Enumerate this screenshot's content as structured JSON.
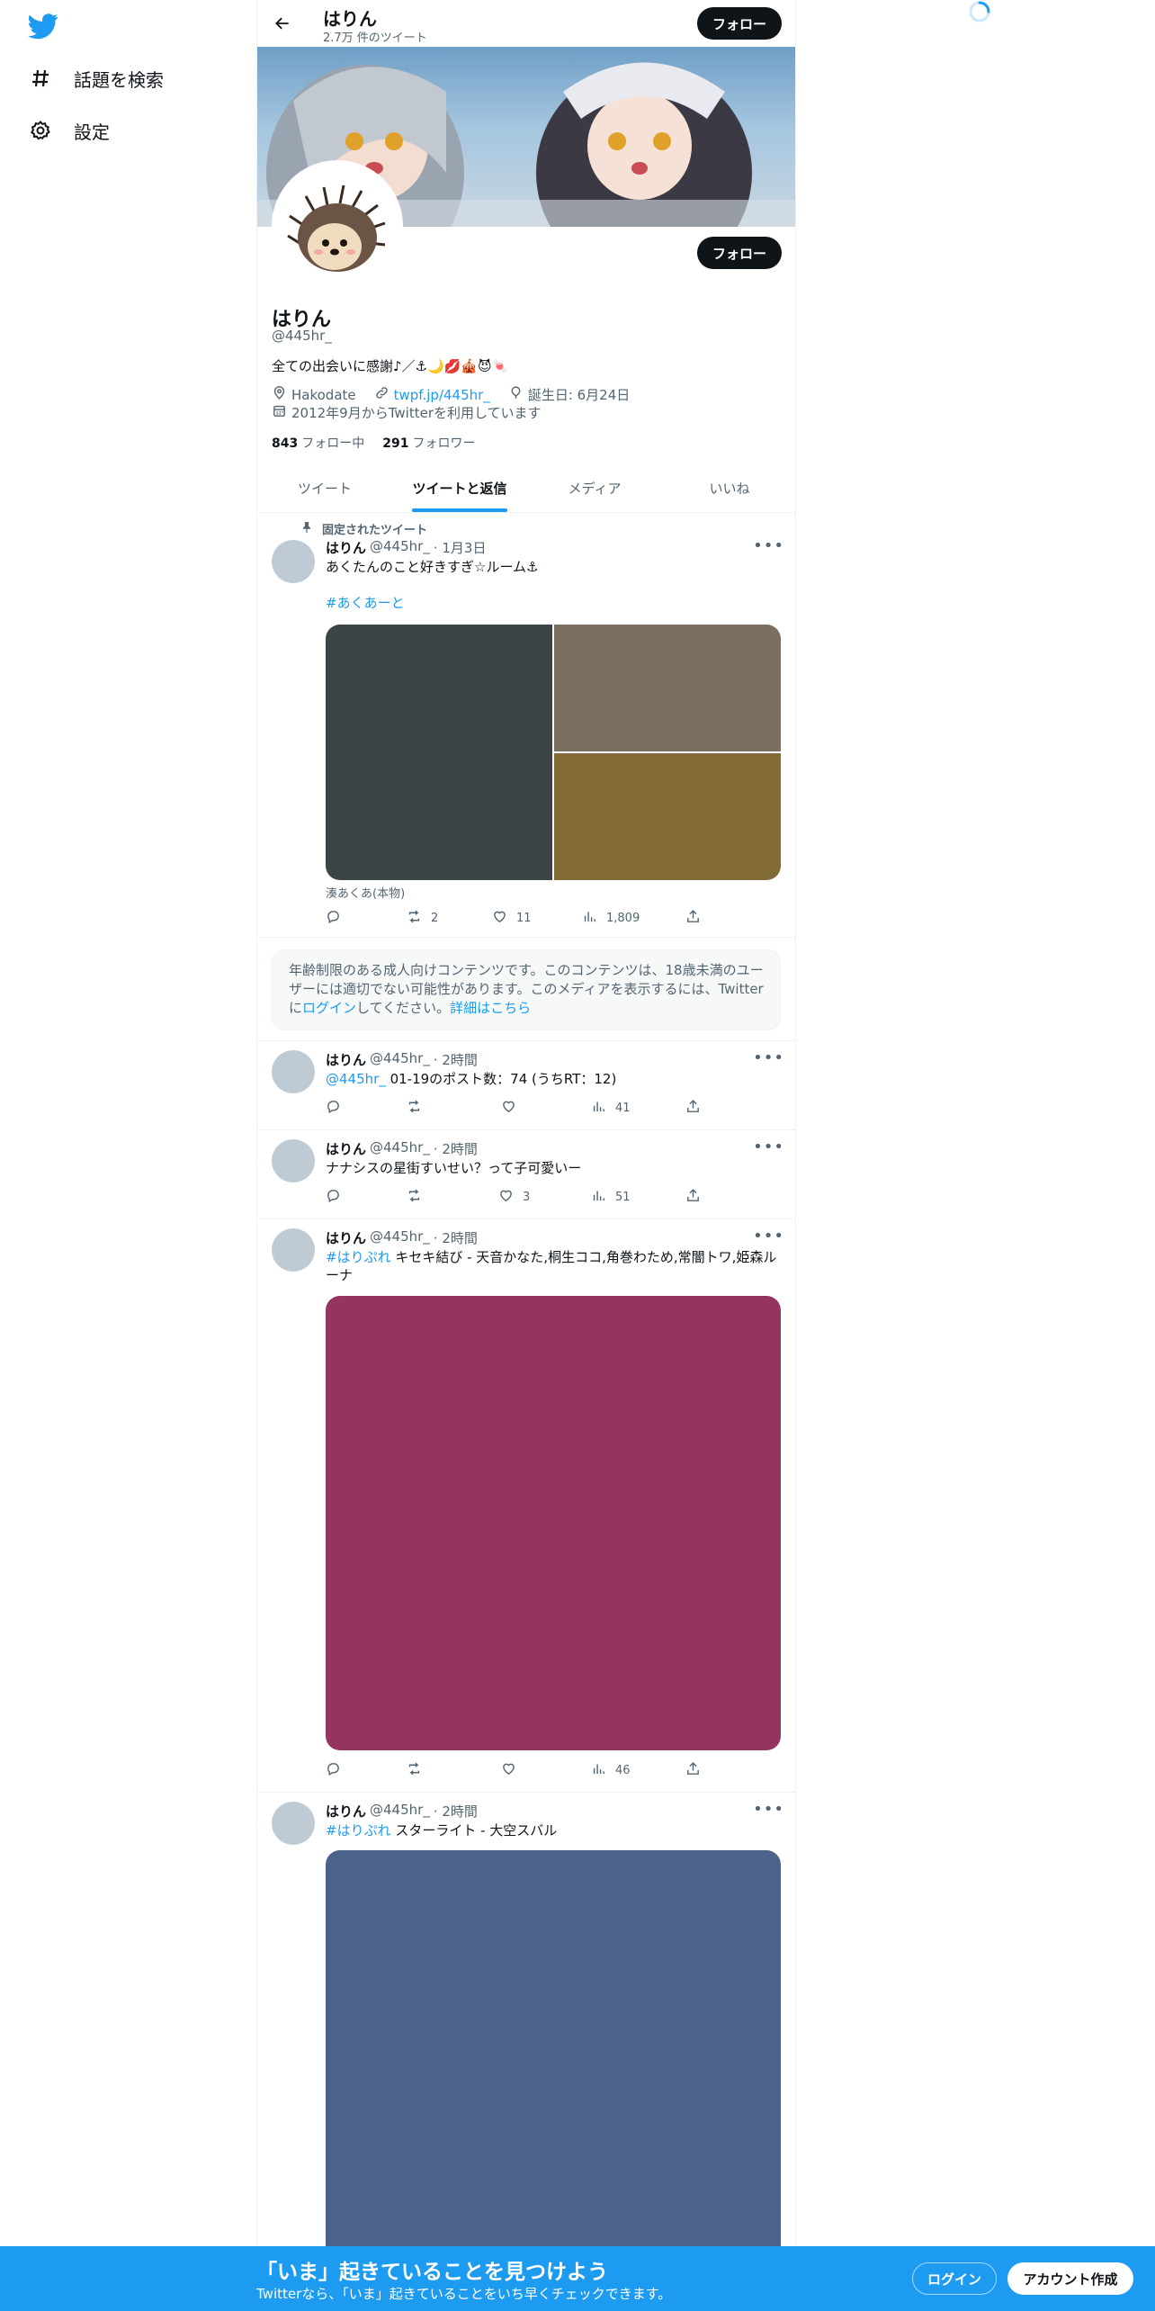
{
  "nav": {
    "items": [
      {
        "label": "話題を検索",
        "icon": "hashtag-icon"
      },
      {
        "label": "設定",
        "icon": "gear-icon"
      }
    ]
  },
  "header": {
    "name": "はりん",
    "tweet_count": "2.7万 件のツイート",
    "follow_label": "フォロー"
  },
  "profile": {
    "name": "はりん",
    "handle": "@445hr_",
    "bio": "全ての出会いに感謝♪／⚓🌙💋🎪😈🍬",
    "location": "Hakodate",
    "link": "twpf.jp/445hr_",
    "birthday": "誕生日: 6月24日",
    "joined": "2012年9月からTwitterを利用しています",
    "following_count": "843",
    "following_label": "フォロー中",
    "followers_count": "291",
    "followers_label": "フォロワー",
    "follow_label": "フォロー"
  },
  "tabs": [
    {
      "label": "ツイート",
      "active": false
    },
    {
      "label": "ツイートと返信",
      "active": true
    },
    {
      "label": "メディア",
      "active": false
    },
    {
      "label": "いいね",
      "active": false
    }
  ],
  "pinned_label": "固定されたツイート",
  "tweets": [
    {
      "name": "はりん",
      "handle": "@445hr_",
      "time": "· 1月3日",
      "text": "あくたんのこと好きすぎ☆ルーム⚓",
      "hashtag": "#あくあーと",
      "caption": "湊あくあ(本物)",
      "replies": "",
      "retweets": "2",
      "likes": "11",
      "views": "1,809",
      "media_colors": [
        "#3d4447",
        "#7b7060",
        "#836b37"
      ]
    },
    {
      "name": "はりん",
      "handle": "@445hr_",
      "time": "· 2時間",
      "mention": "@445hr_",
      "text": " 01-19のポスト数：74 (うちRT：12)",
      "replies": "",
      "retweets": "",
      "likes": "",
      "views": "41"
    },
    {
      "name": "はりん",
      "handle": "@445hr_",
      "time": "· 2時間",
      "text": "ナナシスの星街すいせい？って子可愛いー",
      "replies": "",
      "retweets": "",
      "likes": "3",
      "views": "51"
    },
    {
      "name": "はりん",
      "handle": "@445hr_",
      "time": "· 2時間",
      "hashtag": "#はりぷれ",
      "text": " キセキ結び - 天音かなた,桐生ココ,角巻わため,常闇トワ,姫森ルーナ",
      "replies": "",
      "retweets": "",
      "likes": "",
      "views": "46",
      "media_color": "#93355e"
    },
    {
      "name": "はりん",
      "handle": "@445hr_",
      "time": "· 2時間",
      "hashtag": "#はりぷれ",
      "text": " スターライト - 大空スバル",
      "media_color": "#4b628b"
    }
  ],
  "sensitive_notice": {
    "text": "年齢制限のある成人向けコンテンツです。このコンテンツは、18歳未満のユーザーには適切でない可能性があります。このメディアを表示するには、Twitterに",
    "login_link": "ログイン",
    "text_after": "してください。",
    "learn_more": "詳細はこちら"
  },
  "bottom_bar": {
    "title": "「いま」起きていることを見つけよう",
    "subtitle": "Twitterなら、「いま」起きていることをいち早くチェックできます。",
    "login_label": "ログイン",
    "signup_label": "アカウント作成"
  },
  "colors": {
    "accent": "#1d9bf0",
    "bottom_bar": "#1d9bf0",
    "text": "#0f1419",
    "muted": "#536471"
  }
}
